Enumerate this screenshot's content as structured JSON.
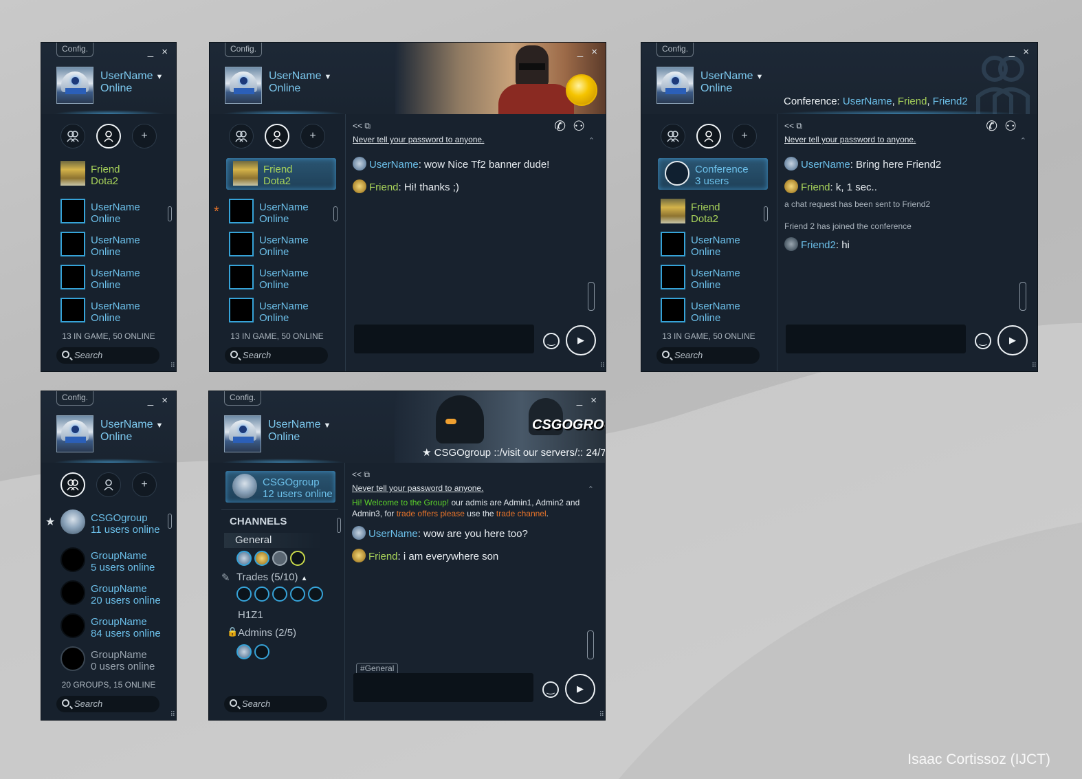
{
  "credit": "Isaac Cortissoz (IJCT)",
  "common": {
    "config": "Config.",
    "window_controls": "_ ×",
    "user_name": "UserName",
    "user_status": "Online",
    "warning": "Never tell your password to anyone.",
    "chat_nav": "<<  ⧉",
    "search": "Search",
    "counts_friends": "13 IN GAME, 50 ONLINE",
    "counts_groups": "20 GROUPS, 15 ONLINE",
    "icons": {
      "tab1": "group-icon",
      "tab2": "person-icon",
      "add": "plus-icon",
      "call": "phone-icon",
      "invite": "add-person-icon",
      "emoji": "smiley-icon",
      "send": "play-icon",
      "search": "magnifier-icon"
    }
  },
  "friends_list": {
    "friend": {
      "name": "Friend",
      "status": "Dota2"
    },
    "user_entries": [
      {
        "name": "UserName",
        "status": "Online"
      },
      {
        "name": "UserName",
        "status": "Online"
      },
      {
        "name": "UserName",
        "status": "Online"
      },
      {
        "name": "UserName",
        "status": "Online"
      }
    ]
  },
  "chat_tf2": {
    "messages": [
      {
        "who": "UserName",
        "text": ": wow Nice Tf2 banner dude!"
      },
      {
        "who": "Friend",
        "text": ":  Hi! thanks ;)"
      }
    ]
  },
  "conference": {
    "label": "Conference:",
    "members": [
      "UserName",
      "Friend",
      "Friend2"
    ],
    "entry": {
      "name": "Conference",
      "status": "3 users"
    },
    "messages": [
      {
        "who": "UserName",
        "text": ": Bring here Friend2"
      },
      {
        "who": "Friend",
        "text": ":  k, 1 sec.."
      }
    ],
    "system1": "a chat request has been sent to Friend2",
    "system2": "Friend 2 has joined the conference",
    "msg3": {
      "who": "Friend2",
      "text": ": hi"
    }
  },
  "groups_list": {
    "items": [
      {
        "name": "CSGOgroup",
        "status": "11 users online"
      },
      {
        "name": "GroupName",
        "status": "5 users online"
      },
      {
        "name": "GroupName",
        "status": "20 users online"
      },
      {
        "name": "GroupName",
        "status": "84 users online"
      },
      {
        "name": "GroupName",
        "status": "0 users online"
      }
    ]
  },
  "group_chat": {
    "logo": "CSGOGROUP",
    "motd": "★ CSGOgroup ::/visit our servers/:: 24/7",
    "group": {
      "name": "CSGOgroup",
      "status": "12 users online"
    },
    "channels_title": "CHANNELS",
    "channels": {
      "general": "General",
      "trades": "Trades (5/10)",
      "h1z1": "H1Z1",
      "admins": "Admins (2/5)"
    },
    "announce_green": "Hi! Welcome to the Group!",
    "announce_1": " our admis are Admin1, Admin2 and Admin3, for ",
    "announce_or1": "trade offers please",
    "announce_2": " use the ",
    "announce_or2": "trade channel",
    "announce_3": ".",
    "messages": [
      {
        "who": "UserName",
        "text": ": wow are you here too?"
      },
      {
        "who": "Friend",
        "text": ":  i am everywhere son"
      }
    ],
    "channel_tag": "#General"
  }
}
